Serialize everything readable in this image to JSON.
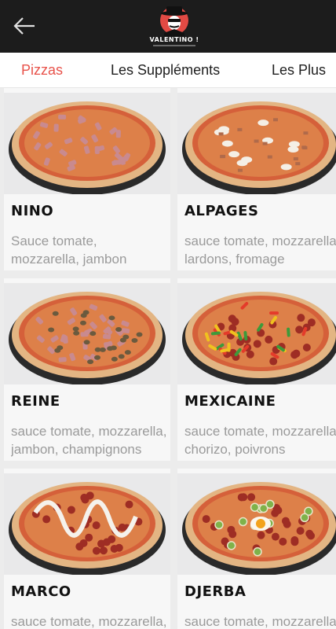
{
  "header": {
    "back_icon": "arrow-left-icon",
    "logo": {
      "name": "VALENTINO !",
      "icon": "gangster-mascot-logo"
    }
  },
  "tabs": [
    {
      "label": "Pizzas",
      "active": true
    },
    {
      "label": "Les Suppléments",
      "active": false
    },
    {
      "label": "Les Plus",
      "active": false
    }
  ],
  "colors": {
    "accent": "#e8524a",
    "topbar": "#1c1c1c",
    "muted_text": "#9a9a9a"
  },
  "pizzas": [
    {
      "name": "NINO",
      "description": "Sauce tomate, mozzarella, jambon",
      "topping": "ham"
    },
    {
      "name": "ALPAGES",
      "description": "sauce tomate, mozzarella, lardons, fromage",
      "topping": "cheese"
    },
    {
      "name": "REINE",
      "description": "sauce tomate, mozzarella, jambon, champignons",
      "topping": "mushroom"
    },
    {
      "name": "MEXICAINE",
      "description": "sauce tomate, mozzarella, chorizo, poivrons",
      "topping": "pepper"
    },
    {
      "name": "MARCO",
      "description": "sauce tomate, mozzarella, chorizo, crème",
      "topping": "cream"
    },
    {
      "name": "DJERBA",
      "description": "sauce tomate, mozzarella, merguez, oeuf",
      "topping": "egg"
    }
  ]
}
